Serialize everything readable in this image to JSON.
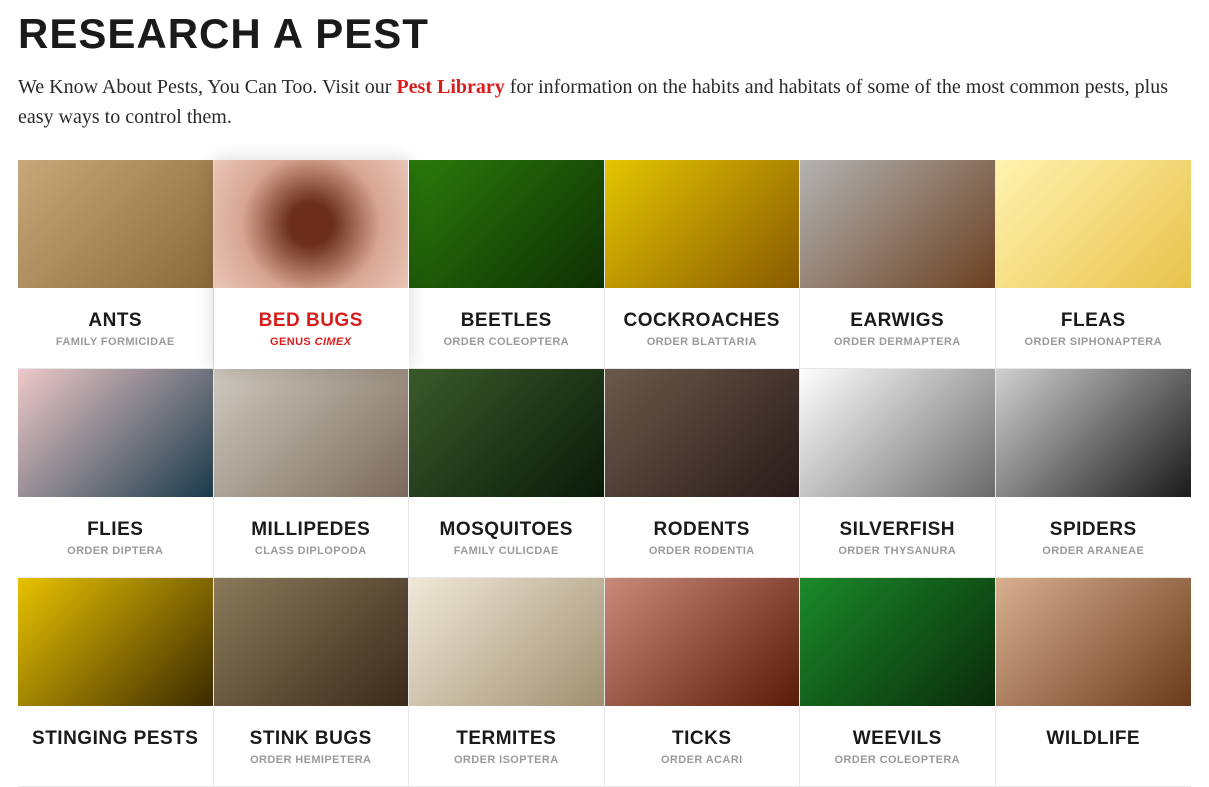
{
  "header": {
    "title": "RESEARCH A PEST",
    "intro_pre": "We Know About Pests, You Can Too. Visit our ",
    "intro_link": "Pest Library",
    "intro_post": " for information on the habits and habitats of some of the most common pests, plus easy ways to control them."
  },
  "active_index": 1,
  "pests": [
    {
      "name": "ANTS",
      "sub": "FAMILY FORMICIDAE",
      "img_class": "ph-ants"
    },
    {
      "name": "BED BUGS",
      "sub_prefix": "GENUS ",
      "sub_italic": "CIMEX",
      "img_class": "ph-bedbugs"
    },
    {
      "name": "BEETLES",
      "sub": "ORDER COLEOPTERA",
      "img_class": "ph-beetles"
    },
    {
      "name": "COCKROACHES",
      "sub": "ORDER BLATTARIA",
      "img_class": "ph-cockroaches"
    },
    {
      "name": "EARWIGS",
      "sub": "ORDER DERMAPTERA",
      "img_class": "ph-earwigs"
    },
    {
      "name": "FLEAS",
      "sub": "ORDER SIPHONAPTERA",
      "img_class": "ph-fleas"
    },
    {
      "name": "FLIES",
      "sub": "ORDER DIPTERA",
      "img_class": "ph-flies"
    },
    {
      "name": "MILLIPEDES",
      "sub": "CLASS DIPLOPODA",
      "img_class": "ph-millipedes"
    },
    {
      "name": "MOSQUITOES",
      "sub": "FAMILY CULICDAE",
      "img_class": "ph-mosquitoes"
    },
    {
      "name": "RODENTS",
      "sub": "ORDER RODENTIA",
      "img_class": "ph-rodents"
    },
    {
      "name": "SILVERFISH",
      "sub": "ORDER THYSANURA",
      "img_class": "ph-silverfish"
    },
    {
      "name": "SPIDERS",
      "sub": "ORDER ARANEAE",
      "img_class": "ph-spiders"
    },
    {
      "name": "STINGING PESTS",
      "sub": "",
      "img_class": "ph-stinging"
    },
    {
      "name": "STINK BUGS",
      "sub": "ORDER HEMIPETERA",
      "img_class": "ph-stinkbugs"
    },
    {
      "name": "TERMITES",
      "sub": "ORDER ISOPTERA",
      "img_class": "ph-termites"
    },
    {
      "name": "TICKS",
      "sub": "ORDER ACARI",
      "img_class": "ph-ticks"
    },
    {
      "name": "WEEVILS",
      "sub": "ORDER COLEOPTERA",
      "img_class": "ph-weevils"
    },
    {
      "name": "WILDLIFE",
      "sub": "",
      "img_class": "ph-wildlife"
    }
  ]
}
